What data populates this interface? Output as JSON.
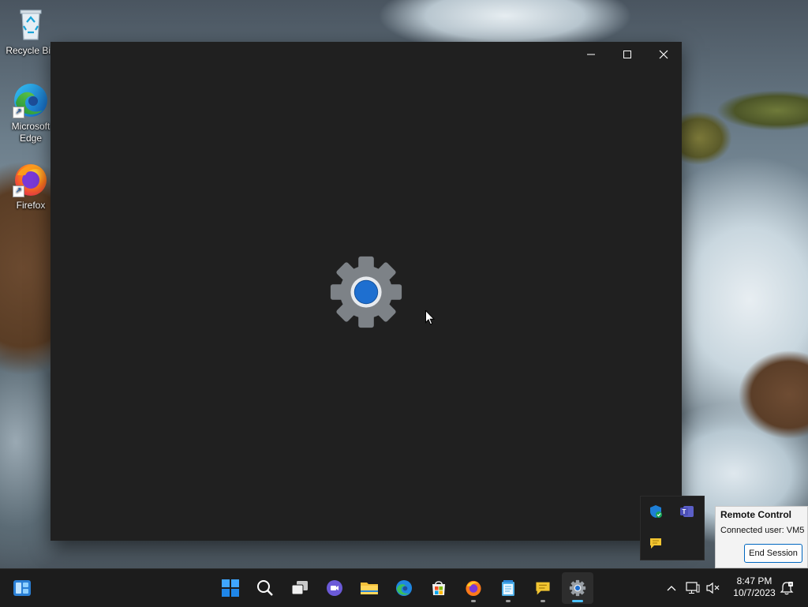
{
  "desktop": {
    "icons": [
      {
        "label": "Recycle Bin",
        "icon": "recycle-bin-icon"
      },
      {
        "label": "Microsoft Edge",
        "icon": "edge-icon"
      },
      {
        "label": "Firefox",
        "icon": "firefox-icon"
      }
    ]
  },
  "window": {
    "controls": {
      "minimize": "—",
      "maximize": "☐",
      "close": "✕"
    },
    "splash_icon": "settings-gear-icon"
  },
  "tray_flyout": {
    "icons": [
      "defender-shield-icon",
      "teams-icon",
      "chat-bubble-icon"
    ]
  },
  "remote_control": {
    "title": "Remote Control",
    "connected_label": "Connected user:",
    "connected_user": "VM5",
    "end_button": "End Session"
  },
  "taskbar": {
    "apps": [
      "start-icon",
      "search-icon",
      "task-view-icon",
      "meet-icon",
      "file-explorer-icon",
      "edge-icon",
      "store-icon",
      "firefox-icon",
      "notepad-icon",
      "chat-bubble-icon",
      "settings-icon"
    ],
    "time": "8:47 PM",
    "date": "10/7/2023"
  },
  "colors": {
    "accent": "#0067c0",
    "window_bg": "#202020",
    "taskbar_bg": "#1c1c1c"
  }
}
